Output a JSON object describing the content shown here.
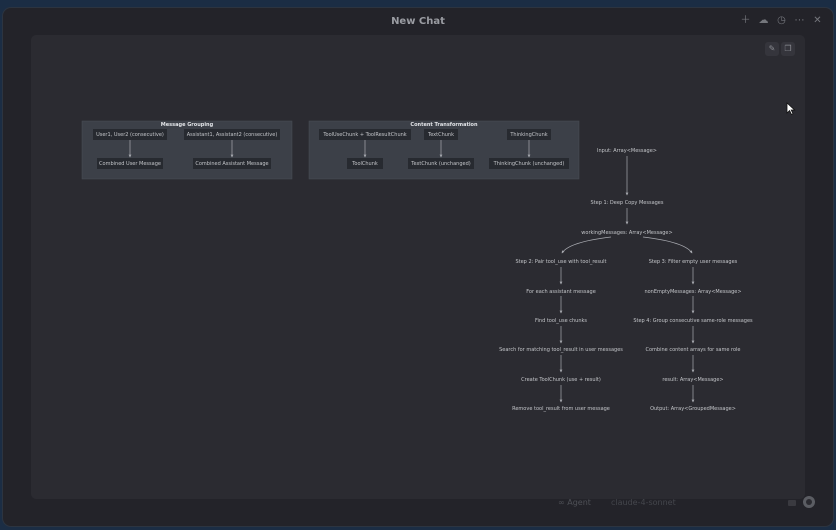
{
  "window": {
    "title": "New Chat",
    "icons": [
      "plus-icon",
      "cloud-icon",
      "history-icon",
      "more-icon",
      "close-icon"
    ]
  },
  "panel": {
    "buttons": [
      "edit-icon",
      "copy-icon"
    ]
  },
  "diagram": {
    "message_grouping": {
      "title": "Message Grouping",
      "left_top": "User1, User2 (consecutive)",
      "left_bottom": "Combined User Message",
      "right_top": "Assistant1, Assistant2 (consecutive)",
      "right_bottom": "Combined Assistant Message"
    },
    "content_transformation": {
      "title": "Content Transformation",
      "col1_top": "ToolUseChunk + ToolResultChunk",
      "col1_bottom": "ToolChunk",
      "col2_top": "TextChunk",
      "col2_bottom": "TextChunk (unchanged)",
      "col3_top": "ThinkingChunk",
      "col3_bottom": "ThinkingChunk (unchanged)"
    },
    "flow": {
      "input": "Input: Array<Message>",
      "step1": "Step 1: Deep Copy Messages",
      "working": "workingMessages: Array<Message>",
      "step2": "Step 2: Pair tool_use with tool_result",
      "each_assistant": "For each assistant message",
      "find_chunks": "Find tool_use chunks",
      "search_matching": "Search for matching tool_result in user messages",
      "create_toolchunk": "Create ToolChunk (use + result)",
      "remove_result": "Remove tool_result from user message",
      "step3": "Step 3: Filter empty user messages",
      "non_empty": "nonEmptyMessages: Array<Message>",
      "step4": "Step 4: Group consecutive same-role messages",
      "combine": "Combine content arrays for same role",
      "result": "result: Array<Message>",
      "output": "Output: Array<GroupedMessage>"
    }
  },
  "bottom": {
    "agent_label": "Agent",
    "model": "claude-4-sonnet"
  }
}
